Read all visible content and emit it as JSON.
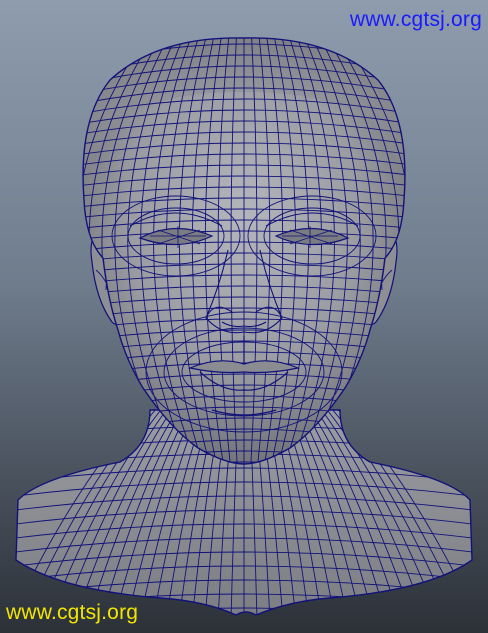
{
  "watermarks": {
    "top_text": "www.cgtsj.org",
    "bottom_text": "www.cgtsj.org",
    "top_color": "#1a1aff",
    "bottom_color": "#f2e600"
  },
  "colors": {
    "wire": "#12127a",
    "skin_light": "#a9abb0",
    "skin_mid": "#8f9196",
    "skin_dark": "#55575c"
  }
}
